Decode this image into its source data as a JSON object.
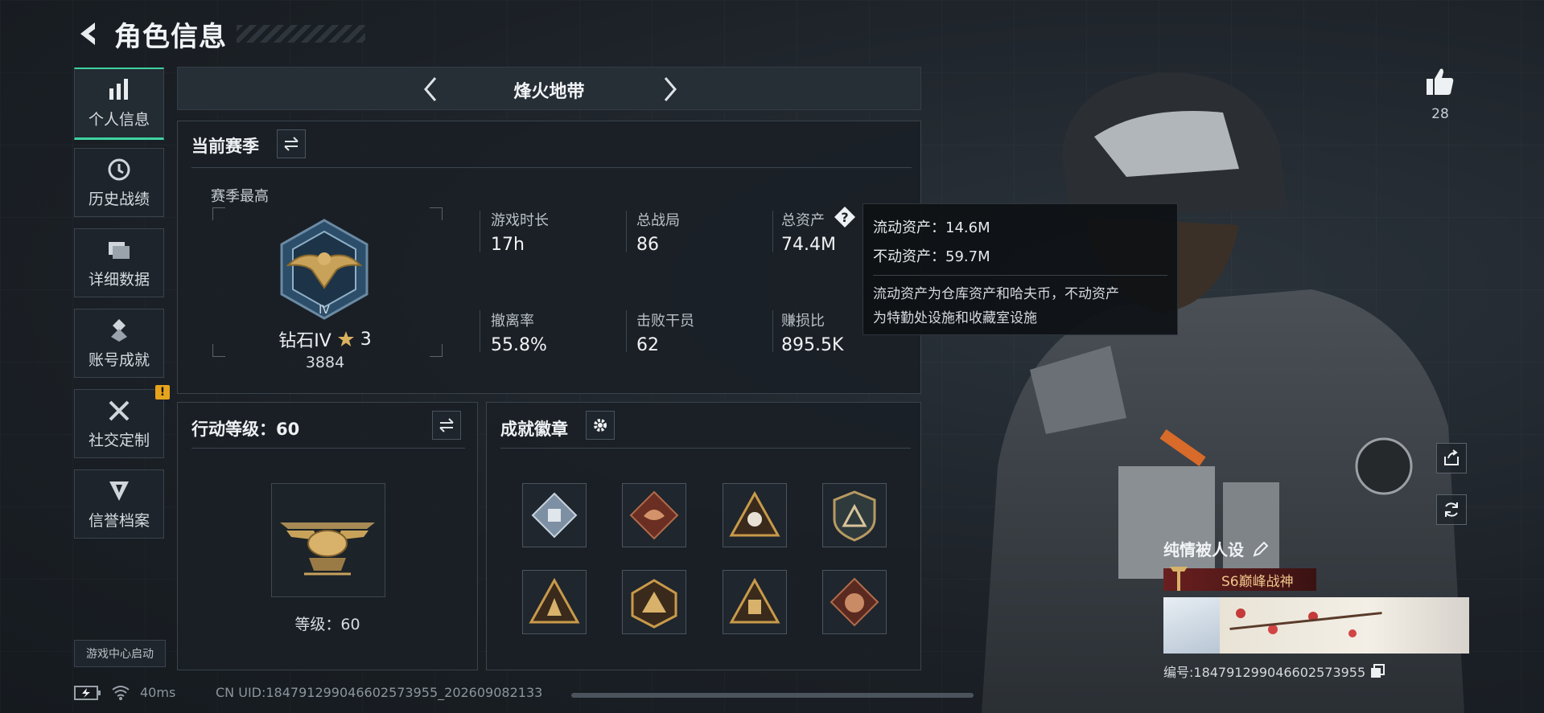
{
  "header": {
    "title": "角色信息"
  },
  "sidebar": {
    "items": [
      {
        "label": "个人信息",
        "icon": "bar-chart-icon",
        "active": true
      },
      {
        "label": "历史战绩",
        "icon": "clock-icon"
      },
      {
        "label": "详细数据",
        "icon": "folder-icon"
      },
      {
        "label": "账号成就",
        "icon": "achievement-icon"
      },
      {
        "label": "社交定制",
        "icon": "tools-icon",
        "badge": "!"
      },
      {
        "label": "信誉档案",
        "icon": "shield-icon"
      }
    ],
    "launch_label": "游戏中心启动"
  },
  "mode": {
    "name": "烽火地带"
  },
  "season": {
    "title": "当前赛季",
    "best_label": "赛季最高",
    "rank_name": "钻石IV",
    "rank_stars": "3",
    "rank_score": "3884",
    "rank_numeral": "IV",
    "stats": [
      {
        "label": "游戏时长",
        "value": "17h"
      },
      {
        "label": "总战局",
        "value": "86"
      },
      {
        "label": "总资产",
        "value": "74.4M"
      },
      {
        "label": "撤离率",
        "value": "55.8%"
      },
      {
        "label": "击败干员",
        "value": "62"
      },
      {
        "label": "赚损比",
        "value": "895.5K"
      }
    ]
  },
  "tooltip": {
    "liquid": "流动资产：14.6M",
    "fixed": "不动资产：59.7M",
    "desc_line1": "流动资产为仓库资产和哈夫币，不动资产",
    "desc_line2": "为特勤处设施和收藏室设施"
  },
  "action_level": {
    "title": "行动等级：60",
    "level_text": "等级：60"
  },
  "achievements": {
    "title": "成就徽章",
    "badges": [
      "diamond-badge",
      "dragon-badge",
      "skull-badge",
      "shield-badge",
      "triangle-badge",
      "hex-badge",
      "fist-badge",
      "beast-badge"
    ]
  },
  "player": {
    "likes": "28",
    "name": "纯情被人设",
    "title": "S6巅峰战神",
    "uid": "编号:18479129904660257395​5"
  },
  "footer": {
    "ping": "40ms",
    "uid": "CN UID:18479129904660257395​5_202609082133"
  },
  "colors": {
    "accent": "#3fd3a0",
    "warn": "#e6a31c",
    "gold": "#c89a4a"
  }
}
